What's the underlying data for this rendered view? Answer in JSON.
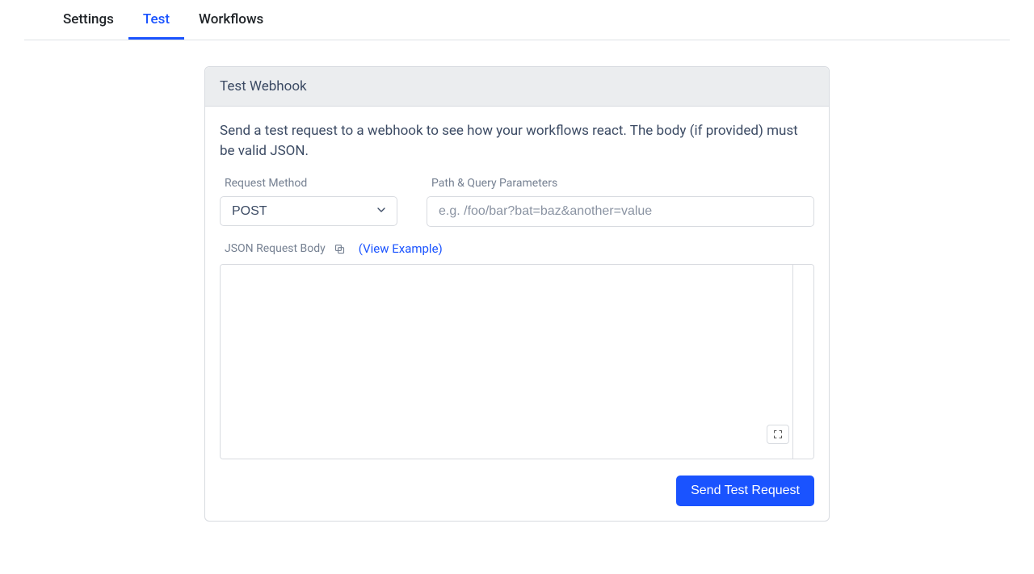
{
  "tabs": {
    "items": [
      {
        "label": "Settings",
        "active": false
      },
      {
        "label": "Test",
        "active": true
      },
      {
        "label": "Workflows",
        "active": false
      }
    ]
  },
  "card": {
    "title": "Test Webhook",
    "description": "Send a test request to a webhook to see how your workflows react. The body (if provided) must be valid JSON.",
    "method": {
      "label": "Request Method",
      "value": "POST"
    },
    "path": {
      "label": "Path & Query Parameters",
      "placeholder": "e.g. /foo/bar?bat=baz&another=value",
      "value": ""
    },
    "body": {
      "label": "JSON Request Body",
      "view_example": "(View Example)",
      "value": ""
    },
    "submit_label": "Send Test Request"
  }
}
